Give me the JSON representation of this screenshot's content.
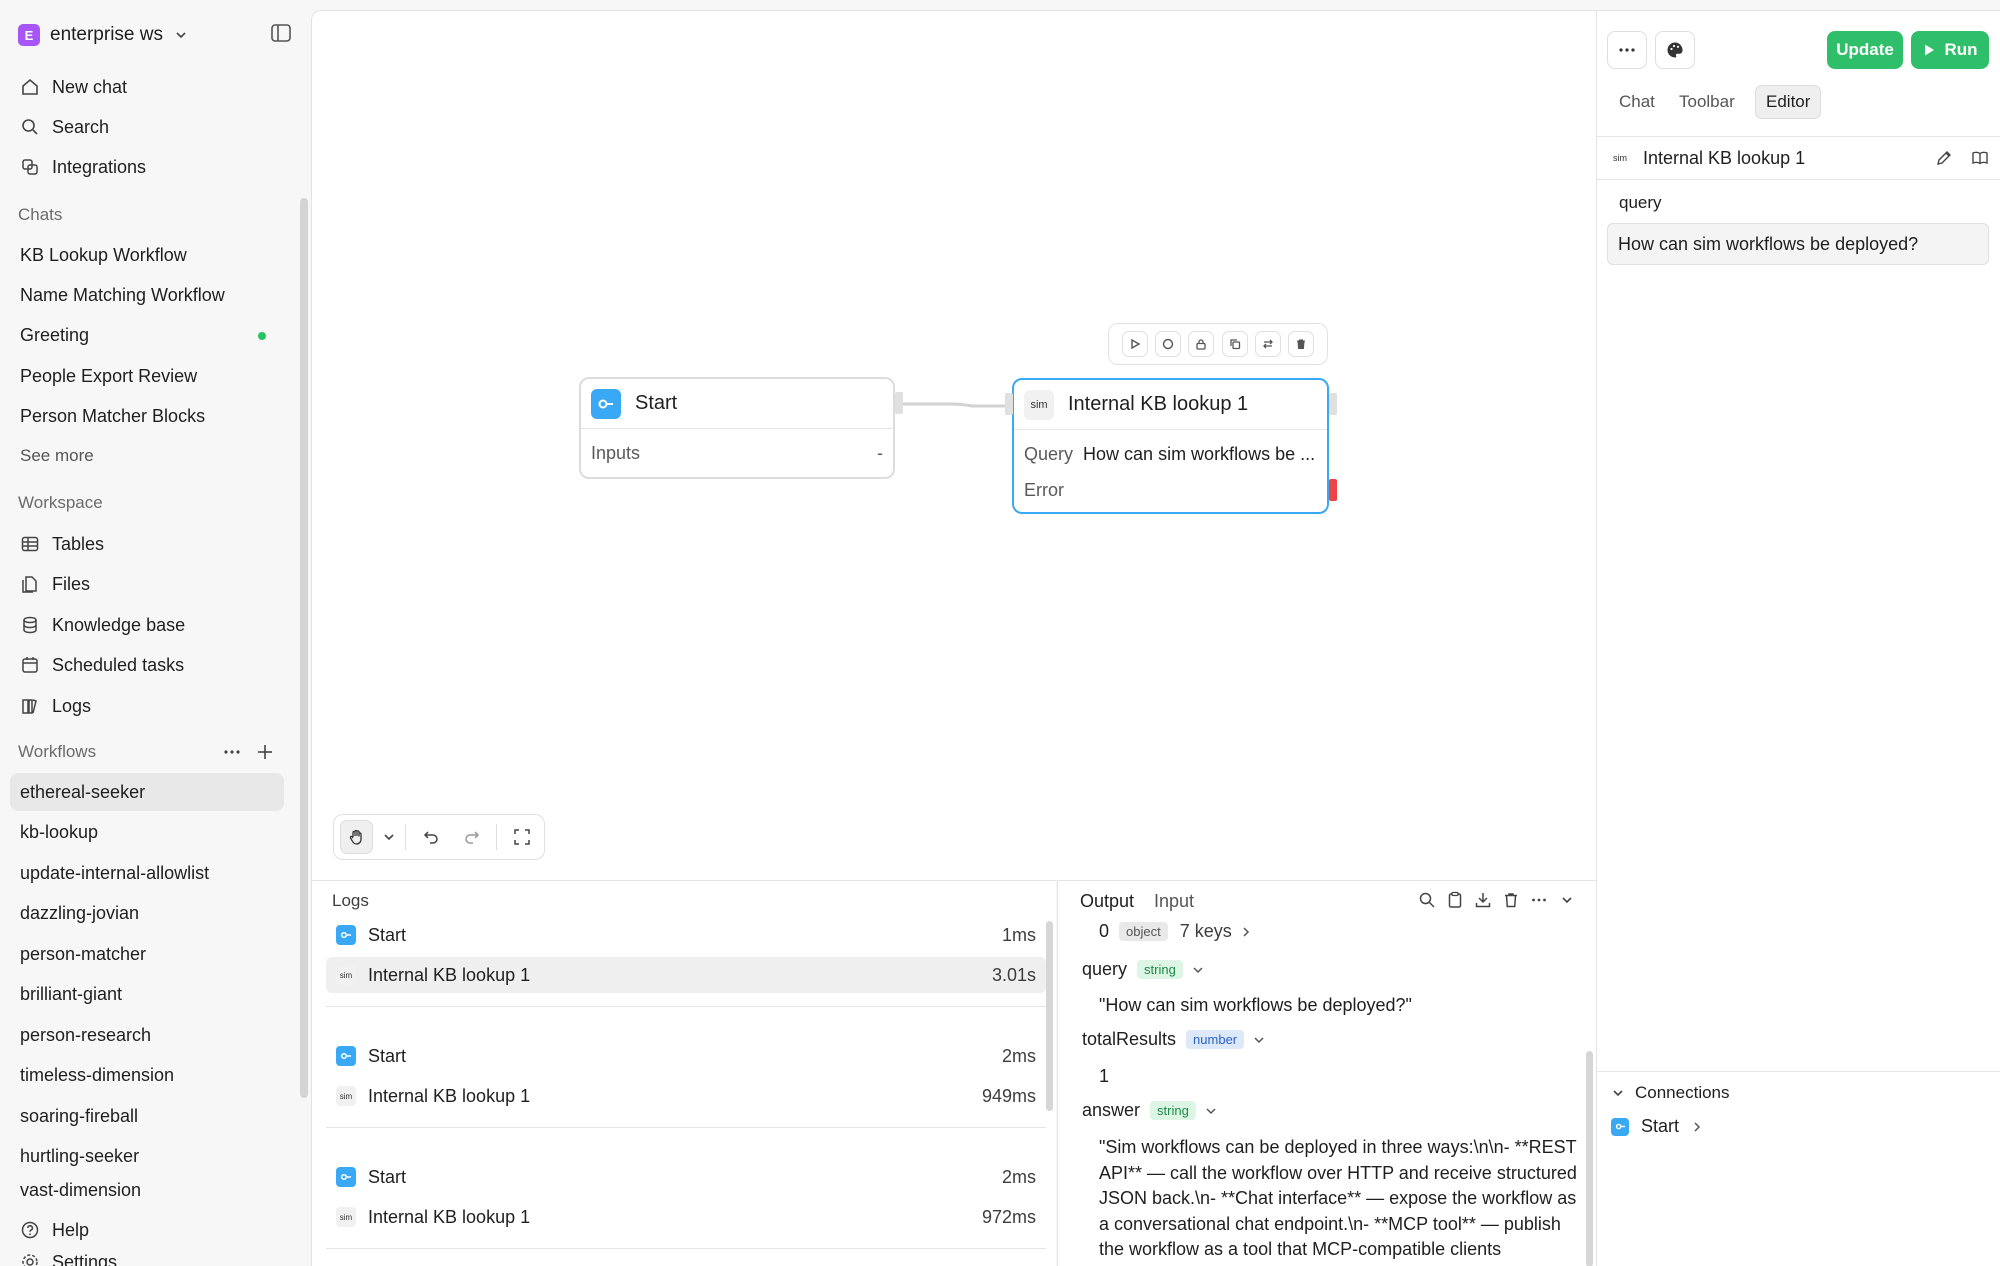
{
  "workspace": {
    "badge": "E",
    "name": "enterprise ws"
  },
  "nav": {
    "new_chat": "New chat",
    "search": "Search",
    "integrations": "Integrations"
  },
  "chats": {
    "label": "Chats",
    "items": [
      "KB Lookup Workflow",
      "Name Matching Workflow",
      "Greeting",
      "People Export Review",
      "Person Matcher Blocks"
    ],
    "see_more": "See more"
  },
  "workspace_section": {
    "label": "Workspace",
    "items": [
      "Tables",
      "Files",
      "Knowledge base",
      "Scheduled tasks",
      "Logs"
    ]
  },
  "workflows": {
    "label": "Workflows",
    "items": [
      "ethereal-seeker",
      "kb-lookup",
      "update-internal-allowlist",
      "dazzling-jovian",
      "person-matcher",
      "brilliant-giant",
      "person-research",
      "timeless-dimension",
      "soaring-fireball",
      "hurtling-seeker",
      "vast-dimension"
    ]
  },
  "footer": {
    "help": "Help",
    "settings": "Settings"
  },
  "canvas": {
    "start_node": {
      "title": "Start",
      "inputs_label": "Inputs",
      "inputs_value": "-"
    },
    "kb_node": {
      "icon_text": "sim",
      "title": "Internal KB lookup 1",
      "query_label": "Query",
      "query_value": "How can sim workflows be ...",
      "error_label": "Error"
    }
  },
  "logs": {
    "title": "Logs",
    "runs": [
      [
        {
          "name": "Start",
          "time": "1ms"
        },
        {
          "name": "Internal KB lookup 1",
          "time": "3.01s"
        }
      ],
      [
        {
          "name": "Start",
          "time": "2ms"
        },
        {
          "name": "Internal KB lookup 1",
          "time": "949ms"
        }
      ],
      [
        {
          "name": "Start",
          "time": "2ms"
        },
        {
          "name": "Internal KB lookup 1",
          "time": "972ms"
        }
      ]
    ]
  },
  "output": {
    "tabs": [
      "Output",
      "Input"
    ],
    "root": {
      "key": "0",
      "type": "object",
      "summary": "7 keys"
    },
    "query": {
      "key": "query",
      "type": "string",
      "value": "\"How can sim workflows be deployed?\""
    },
    "totalResults": {
      "key": "totalResults",
      "type": "number",
      "value": "1"
    },
    "answer": {
      "key": "answer",
      "type": "string",
      "value": "\"Sim workflows can be deployed in three ways:\\n\\n- **REST API** — call the workflow over HTTP and receive structured JSON back.\\n- **Chat interface** — expose the workflow as a conversational chat endpoint.\\n- **MCP tool** — publish the workflow as a tool that MCP-compatible clients"
    }
  },
  "right_panel": {
    "update_label": "Update",
    "run_label": "Run",
    "tabs": [
      "Chat",
      "Toolbar",
      "Editor"
    ],
    "editor_block_icon": "sim",
    "editor_block_title": "Internal KB lookup 1",
    "query_label": "query",
    "query_value": "How can sim workflows be deployed?",
    "connections_label": "Connections",
    "connection_item": "Start"
  },
  "colors": {
    "accent_blue": "#3aa9f5",
    "run_green": "#2fbf6a",
    "error_red": "#ef4444",
    "status_dot": "#22c55e",
    "workspace_purple": "#a855f7"
  }
}
